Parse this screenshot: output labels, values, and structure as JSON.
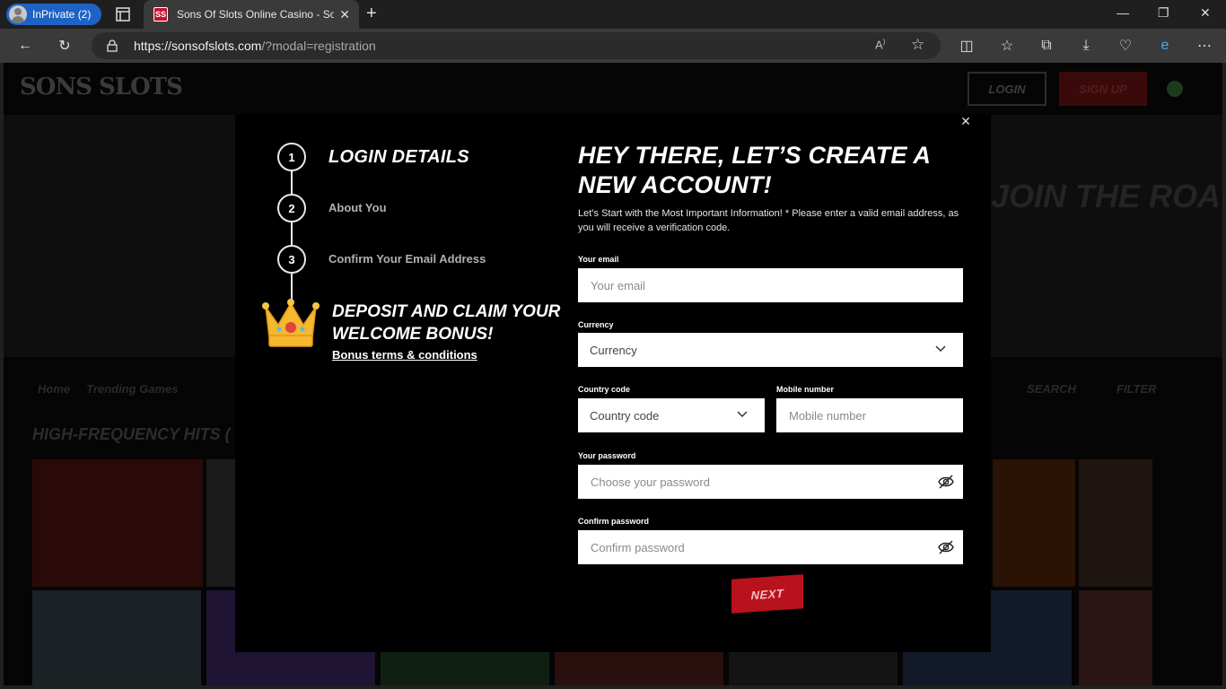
{
  "browser": {
    "profile_label": "InPrivate (2)",
    "tab_title": "Sons Of Slots Online Casino - Sons",
    "favicon_text": "SS",
    "url_host": "https://sonsofslots.com",
    "url_path": "/?modal=registration"
  },
  "site": {
    "logo": "SONS SLOTS",
    "login": "LOGIN",
    "signup": "SIGN UP",
    "hero_text": "JOIN THE ROA",
    "nav_home": "Home",
    "nav_trending": "Trending Games",
    "search": "SEARCH",
    "filter": "FILTER",
    "section_title": "HIGH-FREQUENCY HITS ("
  },
  "modal": {
    "steps": [
      {
        "number": "1",
        "label": "LOGIN DETAILS"
      },
      {
        "number": "2",
        "label": "About You"
      },
      {
        "number": "3",
        "label": "Confirm Your Email Address"
      }
    ],
    "bonus_title": "DEPOSIT AND CLAIM YOUR WELCOME BONUS!",
    "bonus_link": "Bonus terms & conditions",
    "heading": "HEY THERE, LET’S CREATE A NEW ACCOUNT!",
    "subtext": "Let’s Start with the Most Important Information! * Please enter a valid email address, as you will receive a verification code.",
    "email": {
      "label": "Your email",
      "placeholder": "Your email"
    },
    "currency": {
      "label": "Currency",
      "value": "Currency"
    },
    "country_code": {
      "label": "Country code",
      "value": "Country code"
    },
    "mobile": {
      "label": "Mobile number",
      "placeholder": "Mobile number"
    },
    "password": {
      "label": "Your password",
      "placeholder": "Choose your password"
    },
    "confirm": {
      "label": "Confirm password",
      "placeholder": "Confirm password"
    },
    "next": "NEXT"
  }
}
